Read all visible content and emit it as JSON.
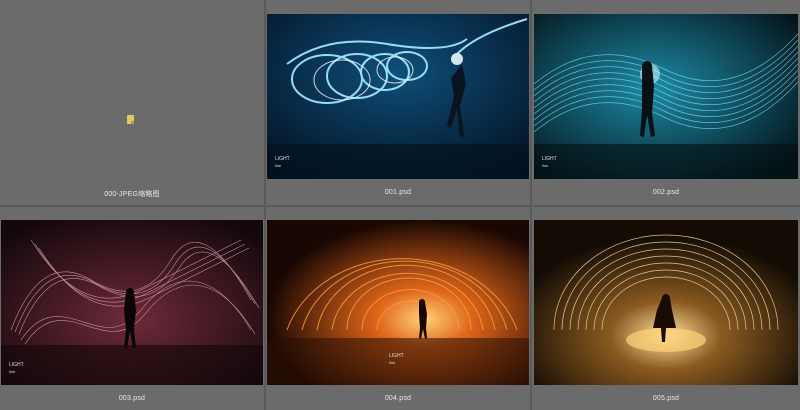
{
  "grid": {
    "items": [
      {
        "file": "000-JPEG缩略图",
        "kind": "folder"
      },
      {
        "file": "001.psd",
        "kind": "image",
        "theme": "blue-spiral"
      },
      {
        "file": "002.psd",
        "kind": "image",
        "theme": "cyan-waves"
      },
      {
        "file": "003.psd",
        "kind": "image",
        "theme": "pink-ribbons"
      },
      {
        "file": "004.psd",
        "kind": "image",
        "theme": "orange-tunnel"
      },
      {
        "file": "005.psd",
        "kind": "image",
        "theme": "gold-arches"
      }
    ]
  },
  "caption": {
    "title1": "LIGHT",
    "title2": "line"
  },
  "colors": {
    "cell_bg": "#6b6b6b",
    "page_bg": "#5a5a5a",
    "label": "#e8e8e8"
  }
}
